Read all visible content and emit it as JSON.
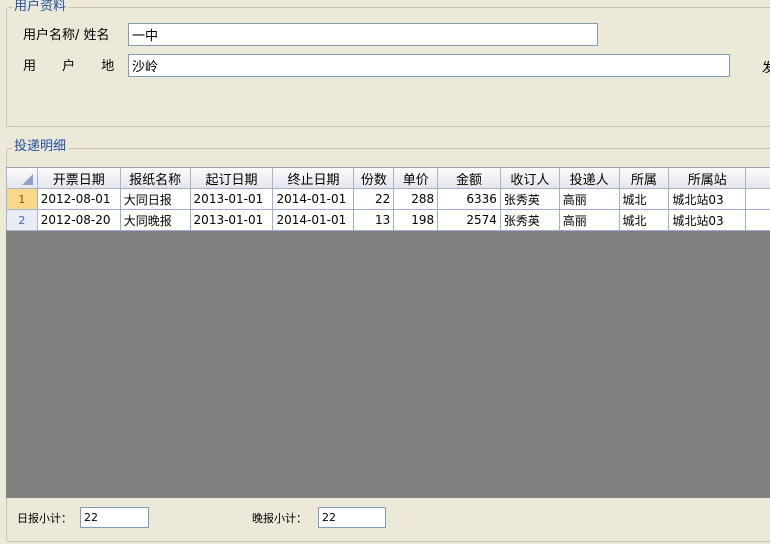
{
  "user_info": {
    "title": "用户资料",
    "name_label": "用户名称/ 姓名",
    "name_value": "一中",
    "address_label": "用 户 地 址",
    "address_value": "沙岭",
    "cut_label": "发"
  },
  "delivery": {
    "title": "投递明细",
    "columns": [
      "开票日期",
      "报纸名称",
      "起订日期",
      "终止日期",
      "份数",
      "单价",
      "金额",
      "收订人",
      "投递人",
      "所属",
      "所属站"
    ],
    "rows": [
      {
        "num": "1",
        "cells": [
          "2012-08-01",
          "大同日报",
          "2013-01-01",
          "2014-01-01",
          "22",
          "288",
          "6336",
          "张秀英",
          "高丽",
          "城北",
          "城北站03"
        ]
      },
      {
        "num": "2",
        "cells": [
          "2012-08-20",
          "大同晚报",
          "2013-01-01",
          "2014-01-01",
          "13",
          "198",
          "2574",
          "张秀英",
          "高丽",
          "城北",
          "城北站03"
        ]
      }
    ]
  },
  "footer": {
    "daily_label": "日报小计：",
    "daily_value": "22",
    "evening_label": "晚报小计：",
    "evening_value": "22"
  }
}
